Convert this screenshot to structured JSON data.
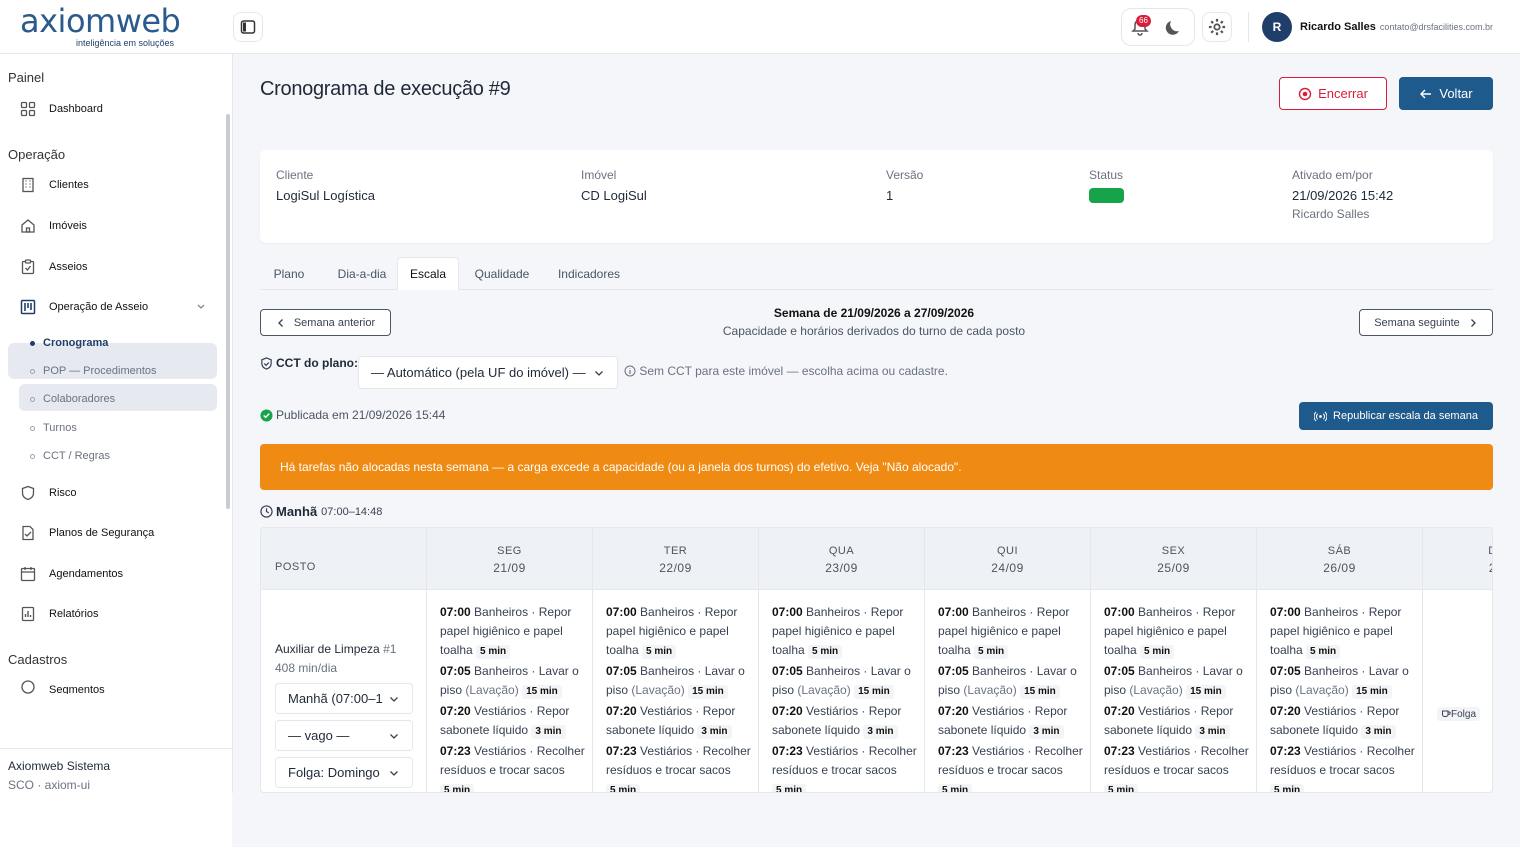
{
  "brand": {
    "name": "axiomweb",
    "tagline": "inteligência em soluções"
  },
  "topbar": {
    "notif_count": "66",
    "user_initial": "R",
    "user_name": "Ricardo Salles",
    "user_email": "contato@drsfacilities.com.br"
  },
  "sidebar": {
    "sec_painel": "Painel",
    "dashboard": "Dashboard",
    "sec_operacao": "Operação",
    "clientes": "Clientes",
    "imoveis": "Imóveis",
    "asseios": "Asseios",
    "operacao_asseio": "Operação de Asseio",
    "subs": [
      "Cronograma",
      "POP — Procedimentos",
      "Colaboradores",
      "Turnos",
      "CCT / Regras"
    ],
    "risco": "Risco",
    "planos": "Planos de Segurança",
    "agendamentos": "Agendamentos",
    "relatorios": "Relatórios",
    "sec_cadastros": "Cadastros",
    "segmentos": "Segmentos",
    "footer_title": "Axiomweb Sistema",
    "footer_sub": "SCO · axiom-ui"
  },
  "page": {
    "title": "Cronograma de execução #9",
    "encerrar": "Encerrar",
    "voltar": "Voltar"
  },
  "info": {
    "cliente_label": "Cliente",
    "cliente": "LogiSul Logística",
    "imovel_label": "Imóvel",
    "imovel": "CD LogiSul",
    "versao_label": "Versão",
    "versao": "1",
    "status_label": "Status",
    "status_color": "#16a34a",
    "ativado_label": "Ativado em/por",
    "ativado_data": "21/09/2026 15:42",
    "ativado_por": "Ricardo Salles"
  },
  "tabs": [
    "Plano",
    "Dia-a-dia",
    "Escala",
    "Qualidade",
    "Indicadores"
  ],
  "week": {
    "prev": "Semana anterior",
    "next": "Semana seguinte",
    "title": "Semana de 21/09/2026 a 27/09/2026",
    "subtitle": "Capacidade e horários derivados do turno de cada posto"
  },
  "cct": {
    "label": "CCT do plano:",
    "value": "— Automático (pela UF do imóvel) —",
    "hint": "Sem CCT para este imóvel — escolha acima ou cadastre."
  },
  "publish": {
    "text": "Publicada em 21/09/2026 15:44",
    "button": "Republicar escala da semana"
  },
  "alert": "Há tarefas não alocadas nesta semana — a carga excede a capacidade (ou a janela dos turnos) do efetivo. Veja \"Não alocado\".",
  "shift": {
    "name": "Manhã",
    "time": "07:00–14:48"
  },
  "grid": {
    "posto_header": "POSTO",
    "days": [
      {
        "d": "SEG",
        "date": "21/09"
      },
      {
        "d": "TER",
        "date": "22/09"
      },
      {
        "d": "QUA",
        "date": "23/09"
      },
      {
        "d": "QUI",
        "date": "24/09"
      },
      {
        "d": "SEX",
        "date": "25/09"
      },
      {
        "d": "SÁB",
        "date": "26/09"
      },
      {
        "d": "D",
        "date": "2"
      }
    ],
    "posto": {
      "name": "Auxiliar de Limpeza",
      "num": "#1",
      "load": "408 min/dia",
      "turno": "Manhã (07:00–1",
      "vago": "— vago —",
      "folga": "Folga: Domingo"
    },
    "tasks": [
      {
        "time": "07:00",
        "text": "Banheiros · Repor papel higiênico e papel toalha",
        "dur": "5 min"
      },
      {
        "time": "07:05",
        "text": "Banheiros · Lavar o piso",
        "extra": "(Lavação)",
        "dur": "15 min"
      },
      {
        "time": "07:20",
        "text": "Vestiários · Repor sabonete líquido",
        "dur": "3 min"
      },
      {
        "time": "07:23",
        "text": "Vestiários · Recolher resíduos e trocar sacos",
        "dur": "5 min"
      }
    ],
    "folga_tag": "Folga"
  }
}
